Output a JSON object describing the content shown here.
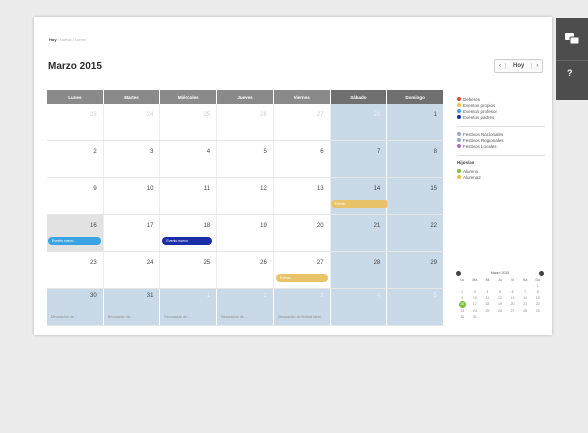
{
  "breadcrumb": {
    "first": "Hoy",
    "sep": " / ",
    "second": "Nueva",
    "third": "Lorem"
  },
  "page_title": "Marzo 2015",
  "nav": {
    "prev": "‹",
    "today": "Hoy",
    "next": "›"
  },
  "weekdays": [
    "Lunes",
    "Martes",
    "Miércoles",
    "Jueves",
    "Viernes",
    "Sábado",
    "Domingo"
  ],
  "weeks": [
    [
      "23",
      "24",
      "25",
      "26",
      "27",
      "28",
      "1"
    ],
    [
      "2",
      "3",
      "4",
      "5",
      "6",
      "7",
      "8"
    ],
    [
      "9",
      "10",
      "11",
      "12",
      "13",
      "14",
      "15"
    ],
    [
      "16",
      "17",
      "18",
      "19",
      "20",
      "21",
      "22"
    ],
    [
      "23",
      "24",
      "25",
      "26",
      "27",
      "28",
      "29"
    ],
    [
      "30",
      "31",
      "1",
      "2",
      "3",
      "4",
      "5"
    ]
  ],
  "events": {
    "sat14": "Evento",
    "mon16": "Evento nuevo",
    "wed18": "Evento nuevo",
    "fri27": "Evento"
  },
  "notes": {
    "mon30": "Decoración de...",
    "tue31": "Decoración de...",
    "wed1": "Decoración de...",
    "thu2": "Decoración de...",
    "fri3": "Decoración de festival ideal..."
  },
  "legend": {
    "types": [
      {
        "label": "Deberes",
        "color": "#e0453a"
      },
      {
        "label": "Eventos propios",
        "color": "#f1c232"
      },
      {
        "label": "Eventos profesor",
        "color": "#3aa3e3"
      },
      {
        "label": "Eventos padres",
        "color": "#1a2ea8"
      }
    ],
    "holidays": [
      {
        "label": "Festivos Nacionales",
        "color": "#9aa9c7"
      },
      {
        "label": "Festivos Regionales",
        "color": "#9aa9c7"
      },
      {
        "label": "Festivos Locales",
        "color": "#b36bbf"
      }
    ],
    "students_heading": "Hijos/as",
    "students": [
      {
        "label": "Alumno",
        "color": "#7bbf3a"
      },
      {
        "label": "Alumna2",
        "color": "#f1c232"
      }
    ]
  },
  "mini_calendar": {
    "title": "Marzo 2015",
    "weekdays": [
      "Lu",
      "Ma",
      "Mi",
      "Ju",
      "Vi",
      "Sá",
      "Do"
    ],
    "weeks": [
      [
        "",
        "",
        "",
        "",
        "",
        "",
        "1"
      ],
      [
        "2",
        "3",
        "4",
        "5",
        "6",
        "7",
        "8"
      ],
      [
        "9",
        "10",
        "11",
        "12",
        "13",
        "14",
        "15"
      ],
      [
        "16",
        "17",
        "18",
        "19",
        "20",
        "21",
        "22"
      ],
      [
        "23",
        "24",
        "25",
        "26",
        "27",
        "28",
        "29"
      ],
      [
        "30",
        "31",
        "",
        "",
        "",
        "",
        ""
      ]
    ],
    "selected": "16"
  },
  "right_panel": {
    "help": "?"
  },
  "colors": {
    "weekend": "#c9d9e8",
    "header": "#8a8a8a",
    "event_light_blue": "#3aa3e3",
    "event_dark_blue": "#1a2ea8",
    "event_yellow": "#e8c36a"
  }
}
